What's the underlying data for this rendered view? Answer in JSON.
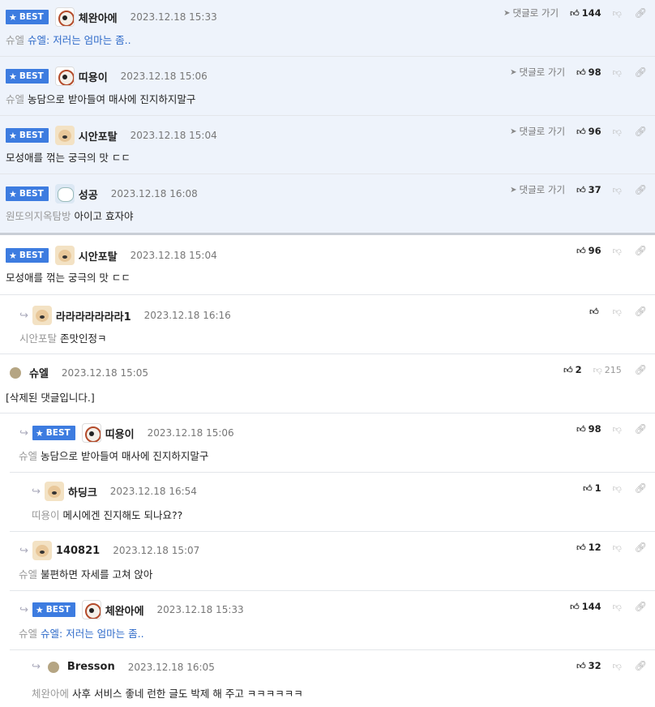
{
  "best_label": "BEST",
  "goto_label": "댓글로 가기",
  "rows": [
    {
      "best": true,
      "nick": "체완아에",
      "date": "2023.12.18 15:33",
      "pre": "슈엘",
      "text": "슈엘: 저러는 엄마는 좀..",
      "text_blue": true,
      "up": "144",
      "down": ""
    },
    {
      "best": true,
      "nick": "띠용이",
      "date": "2023.12.18 15:06",
      "pre": "슈엘",
      "text": "농담으로 받아들여 매사에 진지하지말구",
      "up": "98",
      "down": ""
    },
    {
      "best": true,
      "nick": "시안포탈",
      "date": "2023.12.18 15:04",
      "pre": "",
      "text": "모성애를 꺾는 궁극의 맛 ㄷㄷ",
      "up": "96",
      "down": ""
    },
    {
      "best": true,
      "nick": "성공",
      "date": "2023.12.18 16:08",
      "pre": "원또의지옥탐방",
      "text": "아이고 효자야",
      "up": "37",
      "down": ""
    },
    {
      "best": false,
      "nick": "시안포탈",
      "date": "2023.12.18 15:04",
      "pre": "",
      "text": "모성애를 꺾는 궁극의 맛 ㄷㄷ",
      "up": "96",
      "down": ""
    },
    {
      "best": false,
      "nick": "라라라라라라라1",
      "date": "2023.12.18 16:16",
      "pre": "시안포탈",
      "text": "존맛인정ㅋ",
      "up": "",
      "down": ""
    },
    {
      "best": false,
      "nick": "슈엘",
      "date": "2023.12.18 15:05",
      "pre": "",
      "text": "[삭제된 댓글입니다.]",
      "up": "2",
      "down": "215"
    },
    {
      "best": false,
      "nick": "띠용이",
      "date": "2023.12.18 15:06",
      "pre": "슈엘",
      "text": "농담으로 받아들여 매사에 진지하지말구",
      "up": "98",
      "down": ""
    },
    {
      "best": false,
      "nick": "하딩크",
      "date": "2023.12.18 16:54",
      "pre": "띠용이",
      "text": "메시에겐 진지해도 되나요??",
      "up": "1",
      "down": ""
    },
    {
      "best": false,
      "nick": "140821",
      "date": "2023.12.18 15:07",
      "pre": "슈엘",
      "text": "불편하면 자세를 고쳐 앉아",
      "up": "12",
      "down": ""
    },
    {
      "best": false,
      "nick": "체완아에",
      "date": "2023.12.18 15:33",
      "pre": "슈엘",
      "text": "슈엘: 저러는 엄마는 좀..",
      "text_blue": true,
      "up": "144",
      "down": ""
    },
    {
      "best": false,
      "nick": "Bresson",
      "date": "2023.12.18 16:05",
      "pre": "체완아에",
      "text": "사후 서비스 좋네 런한 글도 박제 해 주고 ㅋㅋㅋㅋㅋㅋ",
      "up": "32",
      "down": ""
    }
  ]
}
